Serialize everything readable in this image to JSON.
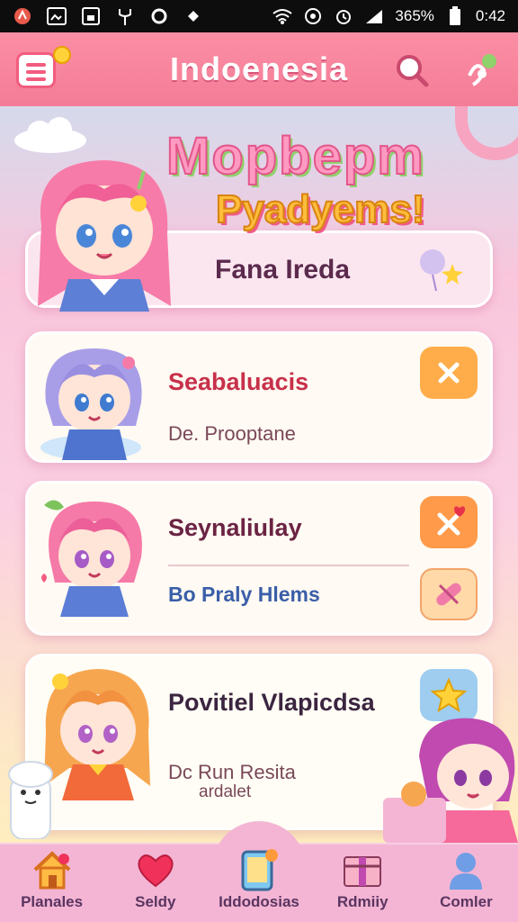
{
  "status_bar": {
    "battery": "365%",
    "time": "0:42"
  },
  "app_bar": {
    "title": "Indoenesia",
    "menu_icon": "menu-icon",
    "search_icon": "search-icon",
    "profile_icon": "mascot-icon"
  },
  "hero": {
    "line1": "Mopbepm",
    "line2": "Pyadyems!",
    "featured_label": "Fana Ireda"
  },
  "cards": [
    {
      "title": "Seabaluacis",
      "subtitle": "De. Prooptane",
      "title_color": "#c8304a",
      "badge_icon": "close-icon",
      "badge_color": "#ffad4a"
    },
    {
      "title": "Seynaliulay",
      "subtitle": "Bo Praly Hlems",
      "title_color": "#6b2343",
      "subtitle_color": "#3a5ea8",
      "badge_icon": "close-heart-icon",
      "badge_color": "#ff9a4a",
      "badge2_icon": "bandage-icon",
      "badge2_color": "#ffd9a8"
    },
    {
      "title": "Povitiel Vlapicdsa",
      "subtitle": "Dc Run Resita",
      "subtitle2": "ardalet",
      "title_color": "#3b2540",
      "badge_icon": "star-icon",
      "badge_color": "#9ecdf0"
    }
  ],
  "nav": [
    {
      "label": "Planales",
      "icon": "house-icon"
    },
    {
      "label": "Seldy",
      "icon": "heart-icon"
    },
    {
      "label": "Iddodosias",
      "icon": "tablet-icon"
    },
    {
      "label": "Rdmiiy",
      "icon": "gift-icon"
    },
    {
      "label": "Comler",
      "icon": "person-icon"
    }
  ]
}
